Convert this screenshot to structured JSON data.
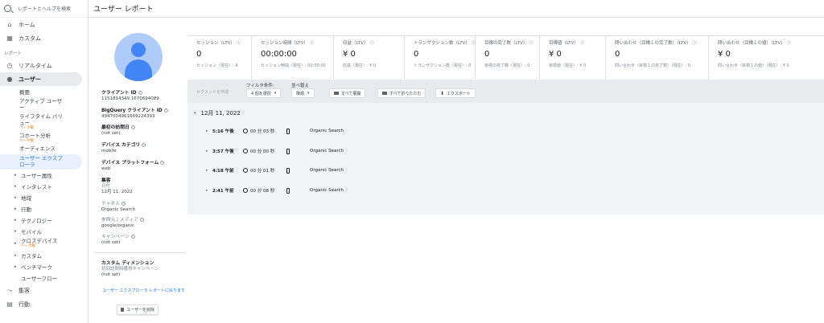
{
  "sidebar": {
    "search_placeholder": "レポートとヘルプを検索",
    "home": "ホーム",
    "custom": "カスタム",
    "reports_section": "レポート",
    "realtime": "リアルタイム",
    "user": "ユーザー",
    "user_subitems": [
      {
        "label": "概要"
      },
      {
        "label": "アクティブ ユーザ ー"
      },
      {
        "label": "ライフタイム バリ ュー",
        "beta": "ベータ版"
      },
      {
        "label": "コホート分析",
        "beta": "ベータ版"
      },
      {
        "label": "オーディエンス"
      },
      {
        "label": "ユーザー エクスプ ローラ"
      }
    ],
    "tree_items": [
      "ユーザー属性",
      "インタレスト",
      "地域",
      "行動",
      "テクノロジー",
      "モバイル",
      "クロスデバイス",
      "カスタム",
      "ベンチマーク"
    ],
    "crossdevice_beta": "ベータ版",
    "user_flow": "ユーザーフロー",
    "acquisition": "集客",
    "behavior": "行動"
  },
  "header": {
    "title": "ユーザー レポート"
  },
  "profile": {
    "client_id_label": "クライアント ID",
    "client_id_value": "1151814349.1670694089",
    "bq_client_id_label": "BigQuery クライアント ID",
    "bq_client_id_value": "4947004961669224393",
    "first_visit_label": "最初の訪問日",
    "first_visit_value": "(not set)",
    "device_category_label": "デバイス カテゴリ",
    "device_category_value": "mobile",
    "device_platform_label": "デバイス プラットフォーム",
    "device_platform_value": "web",
    "acquisition_label": "集客",
    "date_label": "日付",
    "date_value": "12月 11, 2022",
    "channel_label": "チャネル",
    "channel_value": "Organic Search",
    "source_medium_label": "参照元 / メディア",
    "source_medium_value": "google/organic",
    "campaign_label": "キャンペーン",
    "campaign_value": "(not set)",
    "custom_dimension_label": "カスタム ディメンション",
    "custom_dimension_sub": "初回訪問時獲得キャンペーン",
    "custom_dimension_value": "(not set)",
    "back_link": "ユーザー エクスプローラ レポートに戻ります",
    "delete_button": "ユーザーを削除"
  },
  "metrics": [
    {
      "label": "セッション（LTV）",
      "value": "0",
      "sub": "セッション（現在）: 4"
    },
    {
      "label": "セッション時間（LTV）",
      "value": "00:00:00",
      "sub": "セッション時間（現在）: 00:00:00"
    },
    {
      "label": "収益（LTV）",
      "value": "¥ 0",
      "sub": "収益（現在）: ¥ 0"
    },
    {
      "label": "トランザクション数（LTV）",
      "value": "0",
      "sub": "トランザクション数（現在）: 0"
    },
    {
      "label": "目標の完了数（LTV）",
      "value": "0",
      "sub": "目標の完了数（現在）: 0"
    },
    {
      "label": "目標値（LTV）",
      "value": "¥ 0",
      "sub": "目標値（現在）: ¥ 0"
    },
    {
      "label": "問い合わせ（目標１の完了数）（LTV）",
      "value": "0",
      "sub": "問い合わせ（目標１の完了数）（現在）: 0"
    },
    {
      "label": "問い合わせ（目標１の値）（LTV）",
      "value": "¥ 0",
      "sub": "問い合わせ（目標１の値）（現在）: ¥ 0"
    }
  ],
  "toolbar": {
    "segment_placeholder": "セグメントを作成",
    "filter_label": "フィルタ条件:",
    "filter_value": "4 個を選択",
    "sort_label": "並べ替え",
    "sort_value": "降順",
    "expand_all": "すべて展開",
    "collapse_all": "すべて折りたたむ",
    "export": "エクスポート"
  },
  "activity": {
    "date": "12月 11, 2022",
    "sessions": [
      {
        "time": "5:16 午後",
        "duration": "00 分 03 秒",
        "channel": "Organic Search"
      },
      {
        "time": "3:57 午後",
        "duration": "00 分 00 秒",
        "channel": "Organic Search"
      },
      {
        "time": "4:18 午前",
        "duration": "00 分 01 秒",
        "channel": "Organic Search"
      },
      {
        "time": "2:41 午前",
        "duration": "00 分 08 秒",
        "channel": "Organic Search"
      }
    ]
  }
}
